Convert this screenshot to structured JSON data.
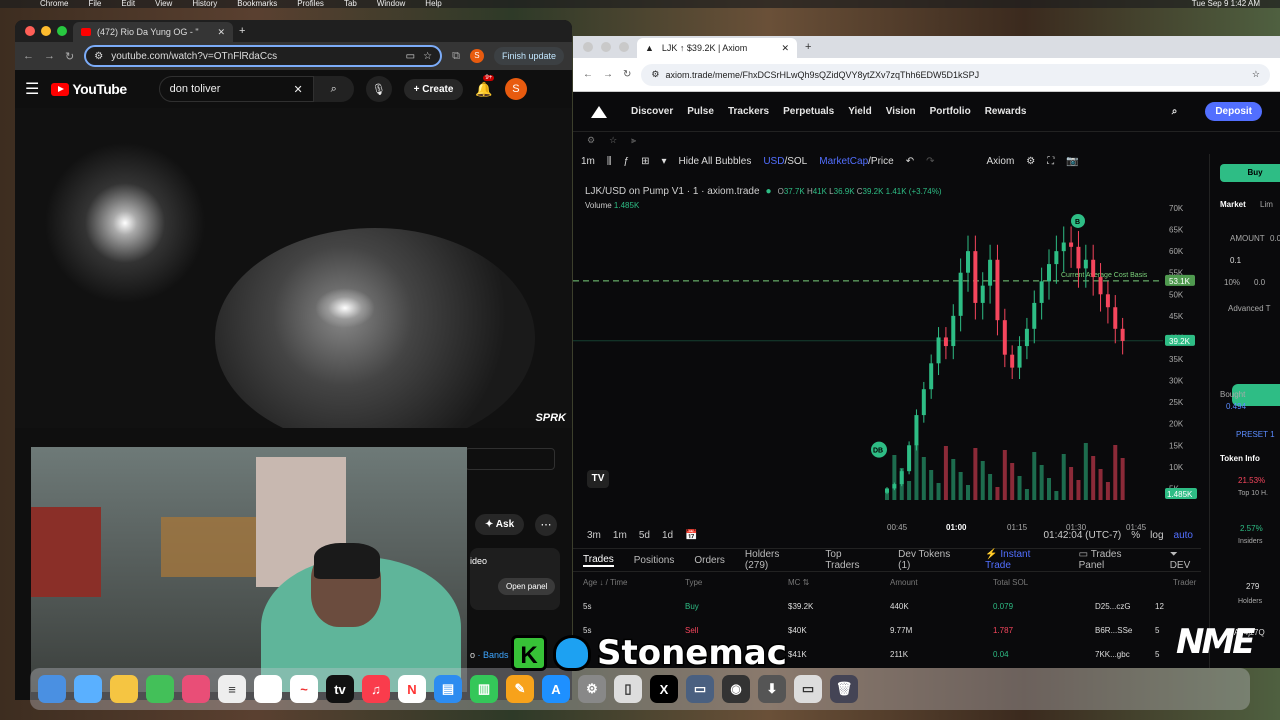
{
  "menubar": {
    "app": "Chrome",
    "items": [
      "File",
      "Edit",
      "View",
      "History",
      "Bookmarks",
      "Profiles",
      "Tab",
      "Window",
      "Help"
    ],
    "clock": "Tue Sep 9  1:42 AM"
  },
  "left_window": {
    "tab_title": "(472) Rio Da Yung OG - \"",
    "url": "youtube.com/watch?v=OTnFlRdaCcs",
    "finish_update": "Finish update",
    "profile_initial": "S",
    "youtube": {
      "logo": "YouTube",
      "search_value": "don toliver",
      "create": "Create",
      "notif_badge": "9+",
      "avatar": "S",
      "watermark": "SPRK",
      "ask": "Ask",
      "video_label": "ideo",
      "open_panel": "Open panel",
      "bottom_text": "o",
      "bands": "Bands"
    }
  },
  "right_window": {
    "tab_title": "LJK ↑ $39.2K | Axiom",
    "url": "axiom.trade/meme/FhxDCSrHLwQh9sQZidQVY8ytZXv7zqThh6EDW5D1kSPJ",
    "nav": [
      "Discover",
      "Pulse",
      "Trackers",
      "Perpetuals",
      "Yield",
      "Vision",
      "Portfolio",
      "Rewards"
    ],
    "deposit": "Deposit",
    "controls": {
      "interval": "1m",
      "hide_bubbles": "Hide All Bubbles",
      "usd": "USD",
      "sol": "/SOL",
      "marketcap": "MarketCap",
      "price": "/Price",
      "source": "Axiom"
    },
    "legend": {
      "pair": "LJK/USD on Pump V1 · 1 · axiom.trade",
      "o": "37.7K",
      "h": "41K",
      "l": "36.9K",
      "c": "39.2K",
      "chg": "1.41K (+3.74%)",
      "volume_label": "Volume",
      "volume_value": "1.485K"
    },
    "bottombar": {
      "ranges": [
        "3m",
        "1m",
        "5d",
        "1d"
      ],
      "time": "01:42:04 (UTC-7)",
      "pct": "%",
      "log": "log",
      "auto": "auto"
    },
    "tabs": [
      "Trades",
      "Positions",
      "Orders",
      "Holders (279)",
      "Top Traders",
      "Dev Tokens (1)"
    ],
    "instant_trade": "Instant Trade",
    "trades_panel": "Trades Panel",
    "dev": "DEV",
    "table_headers": [
      "Age ↓ / Time",
      "Type",
      "MC ⇅",
      "Amount",
      "Total SOL",
      "Trader"
    ],
    "rows": [
      {
        "age": "5s",
        "type": "Buy",
        "mc": "$39.2K",
        "amount": "440K",
        "sol": "0.079",
        "trader": "D25...czG",
        "n": "12"
      },
      {
        "age": "5s",
        "type": "Sell",
        "mc": "$40K",
        "amount": "9.77M",
        "sol": "1.787",
        "trader": "B6R...SSe",
        "n": "5"
      },
      {
        "age": "",
        "type": "",
        "mc": "$41K",
        "amount": "211K",
        "sol": "0.04",
        "trader": "7KK...gbc",
        "n": "5"
      }
    ],
    "side": {
      "buy": "Buy",
      "market": "Market",
      "lim": "Lim",
      "amount": "AMOUNT",
      "amount_val": "0.0",
      "q1": "0.1",
      "pct": "10%",
      "q2": "0.0",
      "adv": "Advanced T",
      "bought": "Bought",
      "bought_val": "0.494",
      "preset": "PRESET 1",
      "token_info": "Token Info",
      "top10": "21.53%",
      "top10_label": "Top 10 H.",
      "insiders": "2.57%",
      "insiders_label": "Insiders",
      "holders": "279",
      "holders_label": "Holders",
      "ca": "A: 4jz7Q"
    }
  },
  "chart_data": {
    "type": "candlestick",
    "title": "LJK/USD on Pump V1 · 1 · axiom.trade",
    "y_ticks": [
      "70K",
      "65K",
      "60K",
      "55K",
      "50K",
      "45K",
      "40K",
      "35K",
      "30K",
      "25K",
      "20K",
      "15K",
      "10K",
      "5K"
    ],
    "x_ticks": [
      "00:45",
      "01:00",
      "01:15",
      "01:30",
      "01:45"
    ],
    "ylim": [
      0,
      70000
    ],
    "markers": {
      "avg_cost_label": "Current Average Cost Basis",
      "avg_cost": "53.1K",
      "last": "39.2K",
      "vol": "1.485K",
      "db": "DB",
      "b": "B"
    },
    "close_values": [
      5000,
      6000,
      9000,
      15000,
      22000,
      28000,
      34000,
      40000,
      38000,
      45000,
      55000,
      60000,
      48000,
      52000,
      58000,
      44000,
      36000,
      33000,
      38000,
      42000,
      48000,
      53000,
      57000,
      60000,
      62000,
      61000,
      56000,
      58000,
      54000,
      50000,
      47000,
      42000,
      39200
    ]
  },
  "overlay": {
    "brand_k": "K",
    "name": "Stonemac",
    "logo": "NME"
  }
}
